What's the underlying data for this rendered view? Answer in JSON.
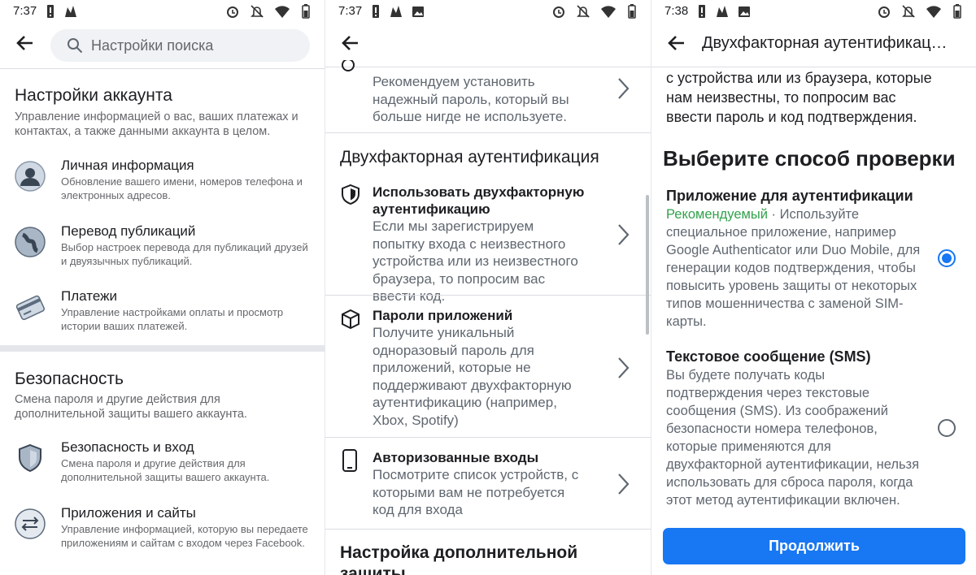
{
  "status": {
    "time1": "7:37",
    "time2": "7:37",
    "time3": "7:38"
  },
  "screen1": {
    "search_placeholder": "Настройки поиска",
    "account": {
      "title": "Настройки аккаунта",
      "desc": "Управление информацией о вас, ваших платежах и контактах, а также данными аккаунта в целом."
    },
    "items": [
      {
        "title": "Личная информация",
        "desc": "Обновление вашего имени, номеров телефона и электронных адресов."
      },
      {
        "title": "Перевод публикаций",
        "desc": "Выбор настроек перевода для публикаций друзей и двуязычных публикаций."
      },
      {
        "title": "Платежи",
        "desc": "Управление настройками оплаты и просмотр истории ваших платежей."
      }
    ],
    "security": {
      "title": "Безопасность",
      "desc": "Смена пароля и другие действия для дополнительной защиты вашего аккаунта."
    },
    "sec_items": [
      {
        "title": "Безопасность и вход",
        "desc": "Смена пароля и другие действия для дополнительной защиты вашего аккаунта."
      },
      {
        "title": "Приложения и сайты",
        "desc": "Управление информацией, которую вы передаете приложениям и сайтам с входом через Facebook."
      }
    ]
  },
  "screen2": {
    "top_desc": "Рекомендуем установить надежный пароль, который вы больше нигде не используете.",
    "twofa_title": "Двухфакторная аутентификация",
    "items": [
      {
        "title": "Использовать двухфакторную аутентификацию",
        "desc": "Если мы зарегистрируем попытку входа с неизвестного устройства или из неизвестного браузера, то попросим вас ввести код."
      },
      {
        "title": "Пароли приложений",
        "desc": "Получите уникальный одноразовый пароль для приложений, которые не поддерживают двухфакторную аутентификацию (например, Xbox, Spotify)"
      },
      {
        "title": "Авторизованные входы",
        "desc": "Посмотрите список устройств, с которыми вам не потребуется код для входа"
      }
    ],
    "extra_title": "Настройка дополнительной защиты"
  },
  "screen3": {
    "title": "Двухфакторная аутентификац…",
    "intro": "с устройства или из браузера, которые нам неизвестны, то попросим вас ввести пароль и код подтверждения.",
    "heading": "Выберите способ проверки",
    "options": [
      {
        "title": "Приложение для аутентификации",
        "badge": "Рекомендуемый",
        "desc": " · Используйте специальное приложение, например Google Authenticator или Duo Mobile, для генерации кодов подтверждения, чтобы повысить уровень защиты от некоторых типов мошенничества с заменой SIM-карты.",
        "selected": true
      },
      {
        "title": "Текстовое сообщение (SMS)",
        "desc": "Вы будете получать коды подтверждения через текстовые сообщения (SMS). Из соображений безопасности номера телефонов, которые применяются для двухфакторной аутентификации, нельзя использовать для сброса пароля, когда этот метод аутентификации включен.",
        "selected": false
      }
    ],
    "continue_label": "Продолжить"
  },
  "colors": {
    "accent": "#1877f2",
    "recommended": "#31a24c"
  }
}
